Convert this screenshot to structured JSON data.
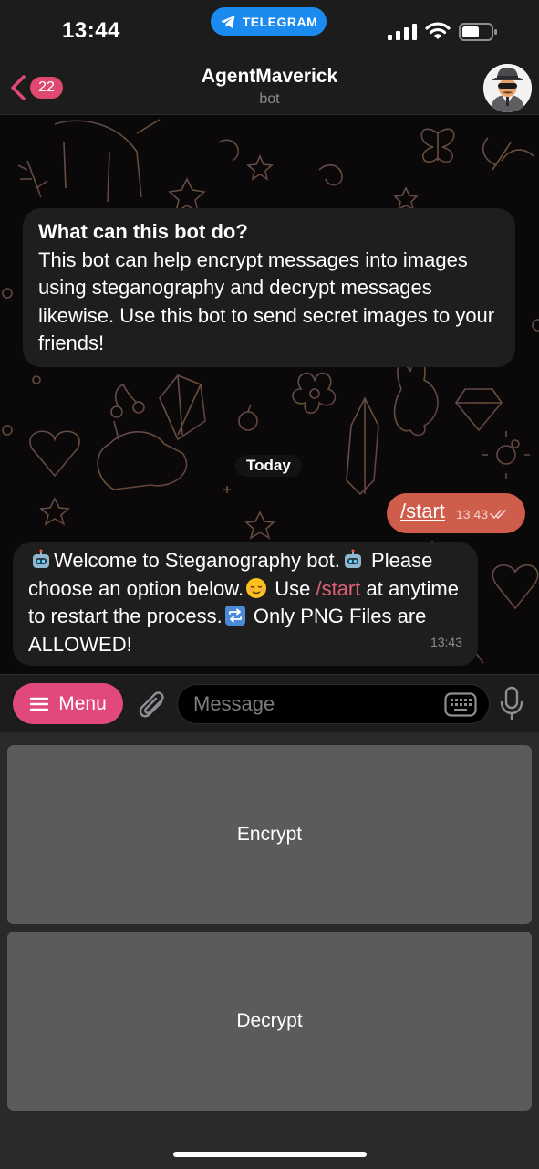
{
  "status_bar": {
    "time": "13:44",
    "app_pill": "TELEGRAM",
    "icons": [
      "signal-icon",
      "wifi-icon",
      "battery-icon"
    ]
  },
  "header": {
    "back_count": "22",
    "title": "AgentMaverick",
    "subtitle": "bot",
    "avatar_icon": "spy-avatar-icon"
  },
  "chat": {
    "info_title": "What can this bot do?",
    "info_text": "This bot can help encrypt messages into images using steganography and decrypt messages likewise. Use this bot to send secret images to your friends!",
    "date_chip": "Today",
    "outgoing": {
      "text": "/start",
      "time": "13:43"
    },
    "incoming": {
      "text_1": "Welcome to Steganography bot.",
      "text_2": "Please choose an option below.",
      "text_3": "Use",
      "link": "/start",
      "text_4": "at anytime to restart the process.",
      "text_5": "Only PNG Files are ALLOWED!",
      "time": "13:43",
      "emoji_icons": [
        "robot-emoji",
        "robot-emoji",
        "relieved-face-emoji",
        "repeat-emoji"
      ]
    }
  },
  "input_bar": {
    "menu_label": "Menu",
    "placeholder": "Message"
  },
  "keyboard": {
    "buttons": [
      "Encrypt",
      "Decrypt"
    ]
  },
  "colors": {
    "accent": "#e0497a",
    "outgoing_bubble": "#ce5d4c",
    "telegram_blue": "#1b8bf0",
    "bubble_bg": "#1e1e1e",
    "keyboard_button": "#5b5b5b"
  }
}
